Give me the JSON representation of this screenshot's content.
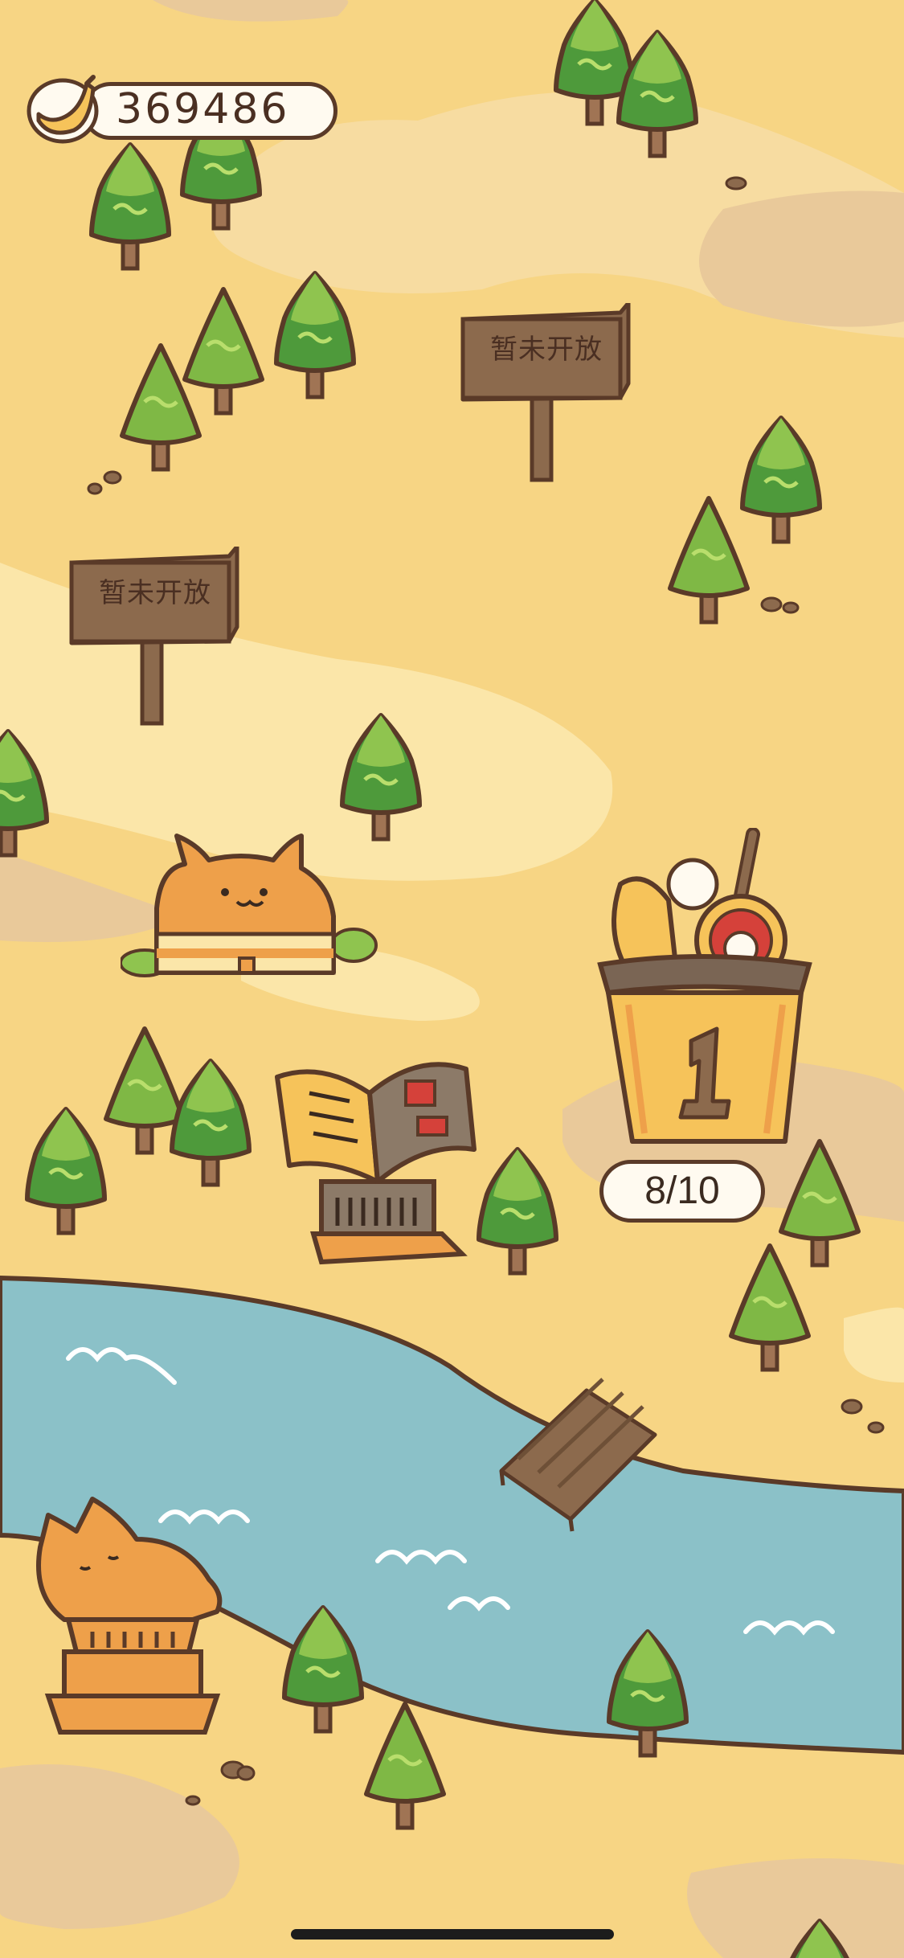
{
  "currency": {
    "icon": "banana-icon",
    "amount": "369486"
  },
  "map": {
    "locked_sign_top": {
      "label": "暂未开放"
    },
    "locked_sign_left": {
      "label": "暂未开放"
    },
    "level_1": {
      "number": "1",
      "progress": "8/10"
    }
  },
  "colors": {
    "sand": "#f7d584",
    "sand_light": "#fbe6a9",
    "river": "#8bc1c8",
    "outline": "#5a3a28",
    "tree": "#7fb845",
    "cat": "#eea04a"
  }
}
